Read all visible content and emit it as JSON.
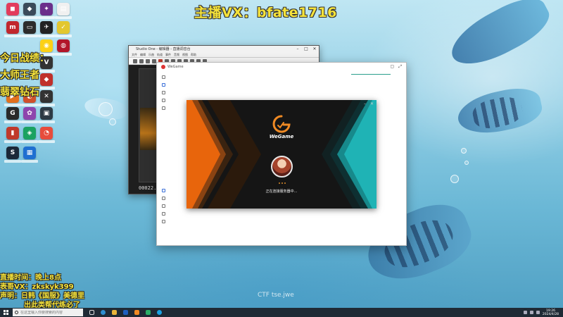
{
  "stream_overlay": {
    "title": "主播VX：bfate1716",
    "left_lines": [
      "今日战绩：",
      "大师王者",
      "翡翠钻石"
    ],
    "bottom_lines": [
      "直播时间：晚上8点",
      "表哥VX：zkskyk399",
      "声明：日韩《国服》美德里",
      "出此类帮代练必了"
    ],
    "watermark": "CTF tse.jwe"
  },
  "desktop_icons": [
    {
      "name": "app-icon",
      "color": "#e23c5c",
      "text": "◼"
    },
    {
      "name": "app-icon",
      "color": "#3a4a5a",
      "text": "◆"
    },
    {
      "name": "app-icon",
      "color": "#6b2f8a",
      "text": "✦"
    },
    {
      "name": "app-icon",
      "color": "#f0f0f0",
      "text": "▤"
    },
    {
      "name": "app-icon",
      "color": "#c1272d",
      "text": "m"
    },
    {
      "name": "app-icon",
      "color": "#2c2c2c",
      "text": "▭"
    },
    {
      "name": "app-icon",
      "color": "#222",
      "text": "✈"
    },
    {
      "name": "app-icon",
      "color": "#e3c72f",
      "text": "✓"
    },
    {
      "name": "app-icon",
      "color": "#fcd116",
      "text": "◉"
    },
    {
      "name": "app-icon",
      "color": "#b2162a",
      "text": "◍"
    },
    {
      "name": "app-icon",
      "color": "#333",
      "text": "V"
    },
    {
      "name": "app-icon",
      "color": "#c0302b",
      "text": "◆"
    },
    {
      "name": "app-icon",
      "color": "#e2701e",
      "text": "▶"
    },
    {
      "name": "app-icon",
      "color": "#d1502b",
      "text": "◐"
    },
    {
      "name": "app-icon",
      "color": "#333",
      "text": "✕"
    },
    {
      "name": "app-icon",
      "color": "#2a2a2a",
      "text": "G"
    },
    {
      "name": "app-icon",
      "color": "#8e44ad",
      "text": "✿"
    },
    {
      "name": "app-icon",
      "color": "#2d3a45",
      "text": "▣"
    },
    {
      "name": "app-icon",
      "color": "#c0392b",
      "text": "▮"
    },
    {
      "name": "app-icon",
      "color": "#1aa260",
      "text": "◈"
    },
    {
      "name": "app-icon",
      "color": "#e74c3c",
      "text": "◔"
    },
    {
      "name": "app-icon",
      "color": "#1b2838",
      "text": "S"
    },
    {
      "name": "app-icon",
      "color": "#1f6fd1",
      "text": "▦"
    }
  ],
  "editor_window": {
    "title": "Studio One - 编辑器 - 直播调音台",
    "menu": [
      "文件",
      "编辑",
      "乐曲",
      "轨道",
      "事件",
      "音频",
      "视图",
      "帮助"
    ],
    "timecode": "00022.02"
  },
  "host_window": {
    "title": "WeGame",
    "sidebar_icons": [
      "home-icon",
      "store-icon",
      "chat-icon",
      "download-icon",
      "library-icon"
    ]
  },
  "wegame_splash": {
    "brand": "WeGame",
    "status": "正在连接服务器中..."
  },
  "taskbar": {
    "search_placeholder": "在这里输入你要搜索的内容",
    "clock_time": "19:26",
    "clock_date": "2024/4/28"
  },
  "colors": {
    "overlay_yellow": "#f5e23a",
    "wegame_orange": "#e8650c",
    "wegame_teal": "#1fb3b5",
    "taskbar_bg": "#1f2a35"
  }
}
